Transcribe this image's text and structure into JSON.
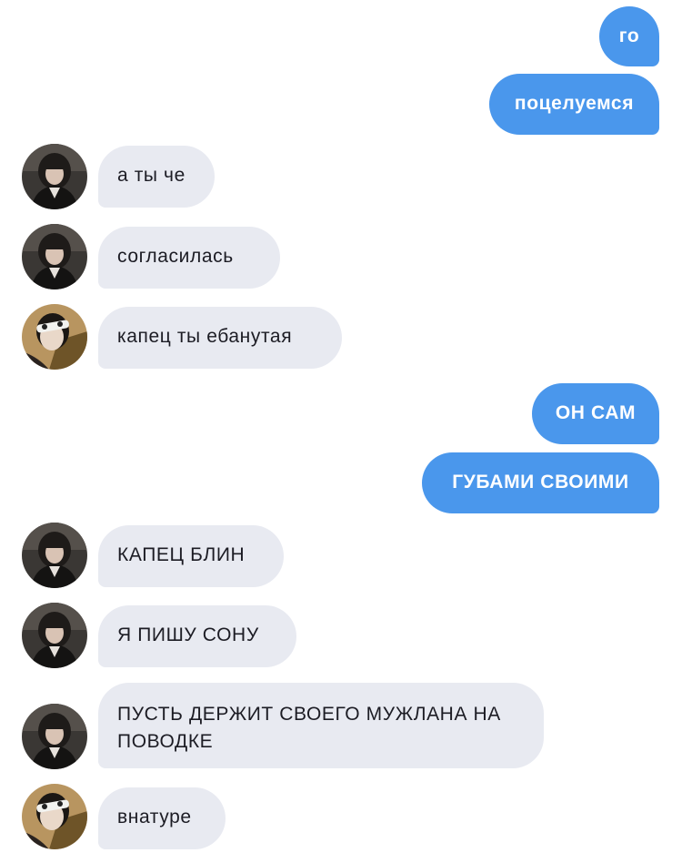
{
  "messages": [
    {
      "side": "out",
      "text": "го"
    },
    {
      "side": "out",
      "text": "поцелуемся"
    },
    {
      "side": "in",
      "avatar": "girl-avatar",
      "text": "а ты че"
    },
    {
      "side": "in",
      "avatar": "girl-avatar",
      "text": "согласилась"
    },
    {
      "side": "in",
      "avatar": "boy-avatar",
      "text": "капец ты ебанутая"
    },
    {
      "side": "out",
      "text": "ОН САМ"
    },
    {
      "side": "out",
      "text": "ГУБАМИ СВОИМИ"
    },
    {
      "side": "in",
      "avatar": "girl-avatar",
      "text": "КАПЕЦ БЛИН"
    },
    {
      "side": "in",
      "avatar": "girl-avatar",
      "text": "Я ПИШУ СОНУ"
    },
    {
      "side": "in",
      "avatar": "girl-avatar",
      "text": "ПУСТЬ ДЕРЖИТ СВОЕГО МУЖЛАНА НА ПОВОДКЕ"
    },
    {
      "side": "in",
      "avatar": "boy-avatar",
      "text": "внатуре"
    }
  ],
  "colors": {
    "outgoing_bubble": "#4a97ec",
    "incoming_bubble": "#e8eaf1",
    "outgoing_text": "#ffffff",
    "incoming_text": "#1c1c24"
  }
}
